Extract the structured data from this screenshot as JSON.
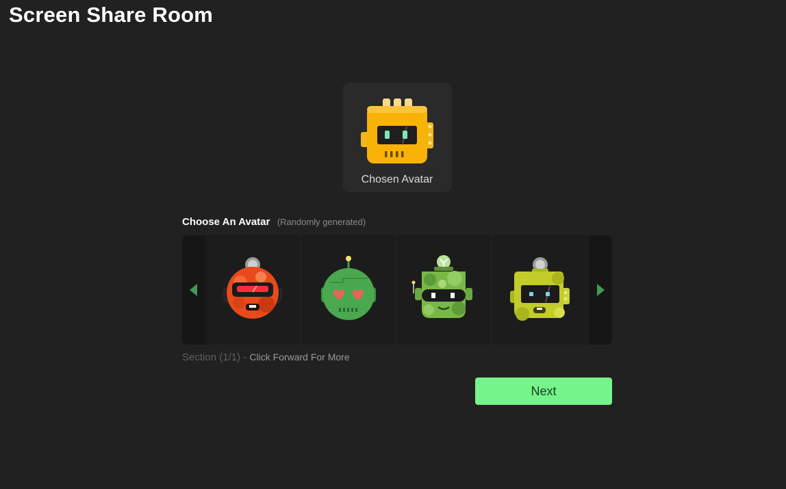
{
  "app": {
    "title": "Screen Share Room"
  },
  "chosen": {
    "label": "Chosen Avatar",
    "avatar_icon": "yellow-robot-icon"
  },
  "chooser": {
    "title": "Choose An Avatar",
    "subtitle": "(Randomly generated)",
    "prev_icon": "chevron-left-icon",
    "next_icon": "chevron-right-icon",
    "avatars": [
      {
        "icon": "red-visor-robot-icon"
      },
      {
        "icon": "green-heart-eyes-robot-icon"
      },
      {
        "icon": "camo-green-robot-icon"
      },
      {
        "icon": "lime-robot-icon"
      }
    ]
  },
  "section": {
    "count": "Section (1/1)",
    "separator": " - ",
    "hint": "Click Forward For More"
  },
  "actions": {
    "next_label": "Next"
  },
  "colors": {
    "background": "#212121",
    "accent": "#75f48c",
    "nav_arrow": "#3f9a55"
  }
}
